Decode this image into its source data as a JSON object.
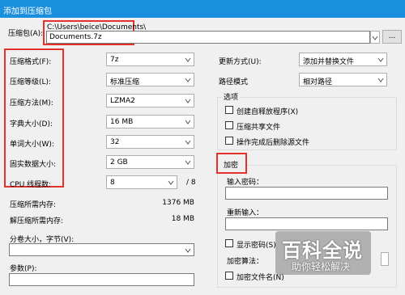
{
  "window": {
    "title": "添加到压缩包"
  },
  "archive": {
    "label": "压缩包(A):",
    "path": "C:\\Users\\beice\\Documents\\",
    "filename": "Documents.7z",
    "browse_label": "..."
  },
  "options_left": [
    {
      "label": "压缩格式(F):",
      "value": "7z"
    },
    {
      "label": "压缩等级(L):",
      "value": "标准压缩"
    },
    {
      "label": "压缩方法(M):",
      "value": "LZMA2"
    },
    {
      "label": "字典大小(D):",
      "value": "16 MB"
    },
    {
      "label": "单词大小(W):",
      "value": "32"
    },
    {
      "label": "固实数据大小:",
      "value": "2 GB"
    },
    {
      "label": "CPU 线程数:",
      "value": "8",
      "suffix": "/ 8"
    }
  ],
  "memory": {
    "compress_label": "压缩所需内存:",
    "compress_value": "1376 MB",
    "decompress_label": "解压缩所需内存:",
    "decompress_value": "18 MB"
  },
  "split": {
    "label": "分卷大小，字节(V):",
    "value": ""
  },
  "params": {
    "label": "参数(P):",
    "value": ""
  },
  "update_mode": {
    "label": "更新方式(U):",
    "value": "添加并替换文件"
  },
  "path_mode": {
    "label": "路径模式",
    "value": "相对路径"
  },
  "options_group": {
    "title": "选项",
    "items": [
      {
        "label": "创建自释放程序(X)",
        "checked": false
      },
      {
        "label": "压缩共享文件",
        "checked": false
      },
      {
        "label": "操作完成后删除源文件",
        "checked": false
      }
    ]
  },
  "encryption": {
    "title": "加密",
    "password_label": "输入密码：",
    "password_value": "",
    "reenter_label": "重新输入：",
    "reenter_value": "",
    "show_password_label": "显示密码(S)",
    "method_label": "加密算法：",
    "encrypt_names_label": "加密文件名(N)"
  },
  "watermark": {
    "line1": "百科全说",
    "line2": "助你轻松解决"
  },
  "colors": {
    "titlebar": "#1a8fde",
    "highlight": "#e2322b"
  }
}
